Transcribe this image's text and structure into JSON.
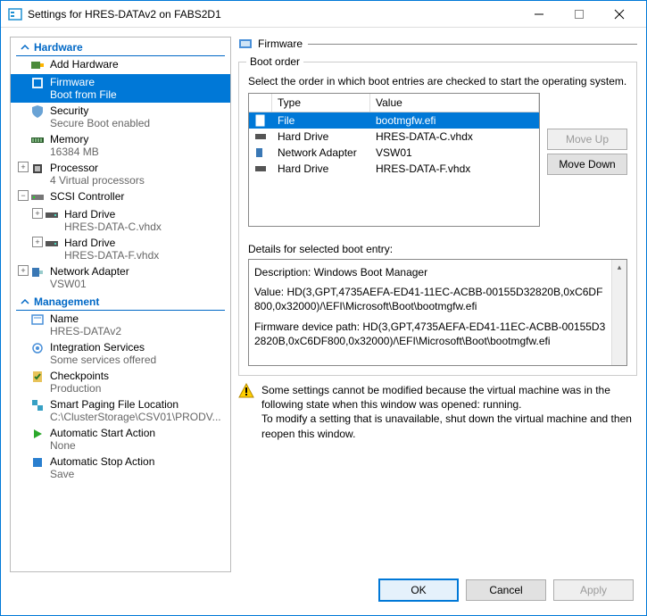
{
  "window": {
    "title": "Settings for HRES-DATAv2 on FABS2D1"
  },
  "sidebar": {
    "hardware_label": "Hardware",
    "management_label": "Management",
    "add_hardware": "Add Hardware",
    "firmware": {
      "label": "Firmware",
      "sub": "Boot from File"
    },
    "security": {
      "label": "Security",
      "sub": "Secure Boot enabled"
    },
    "memory": {
      "label": "Memory",
      "sub": "16384 MB"
    },
    "processor": {
      "label": "Processor",
      "sub": "4 Virtual processors"
    },
    "scsi": {
      "label": "SCSI Controller"
    },
    "hd1": {
      "label": "Hard Drive",
      "sub": "HRES-DATA-C.vhdx"
    },
    "hd2": {
      "label": "Hard Drive",
      "sub": "HRES-DATA-F.vhdx"
    },
    "net": {
      "label": "Network Adapter",
      "sub": "VSW01"
    },
    "name": {
      "label": "Name",
      "sub": "HRES-DATAv2"
    },
    "integ": {
      "label": "Integration Services",
      "sub": "Some services offered"
    },
    "check": {
      "label": "Checkpoints",
      "sub": "Production"
    },
    "paging": {
      "label": "Smart Paging File Location",
      "sub": "C:\\ClusterStorage\\CSV01\\PRODV..."
    },
    "astart": {
      "label": "Automatic Start Action",
      "sub": "None"
    },
    "astop": {
      "label": "Automatic Stop Action",
      "sub": "Save"
    }
  },
  "panel": {
    "title": "Firmware",
    "boot_group": "Boot order",
    "boot_desc": "Select the order in which boot entries are checked to start the operating system.",
    "col_type": "Type",
    "col_value": "Value",
    "rows": [
      {
        "type": "File",
        "value": "bootmgfw.efi"
      },
      {
        "type": "Hard Drive",
        "value": "HRES-DATA-C.vhdx"
      },
      {
        "type": "Network Adapter",
        "value": "VSW01"
      },
      {
        "type": "Hard Drive",
        "value": "HRES-DATA-F.vhdx"
      }
    ],
    "move_up": "Move Up",
    "move_down": "Move Down",
    "details_label": "Details for selected boot entry:",
    "details": {
      "l1": "Description: Windows Boot Manager",
      "l2": "Value: HD(3,GPT,4735AEFA-ED41-11EC-ACBB-00155D32820B,0xC6DF800,0x32000)/\\EFI\\Microsoft\\Boot\\bootmgfw.efi",
      "l3": "Firmware device path: HD(3,GPT,4735AEFA-ED41-11EC-ACBB-00155D32820B,0xC6DF800,0x32000)/\\EFI\\Microsoft\\Boot\\bootmgfw.efi"
    },
    "warning": "Some settings cannot be modified because the virtual machine was in the following state when this window was opened: running.\nTo modify a setting that is unavailable, shut down the virtual machine and then reopen this window."
  },
  "buttons": {
    "ok": "OK",
    "cancel": "Cancel",
    "apply": "Apply"
  }
}
